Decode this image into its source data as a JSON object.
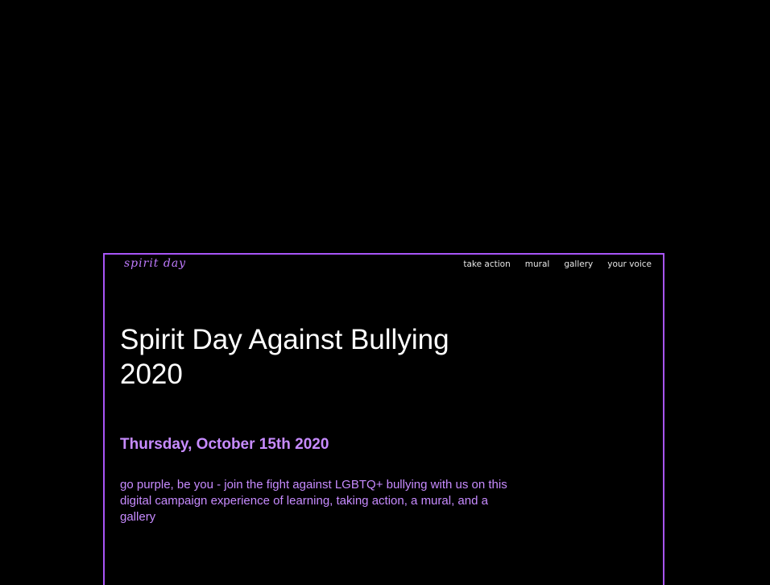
{
  "header": {
    "logo_text": "spirit day",
    "nav": [
      {
        "label": "take action"
      },
      {
        "label": "mural"
      },
      {
        "label": "gallery"
      },
      {
        "label": "your voice"
      }
    ]
  },
  "hero": {
    "title": "Spirit Day Against Bullying 2020",
    "date": "Thursday, October 15th 2020",
    "description": "go purple, be you - join the fight against LGBTQ+ bullying with us on this digital campaign experience of learning, taking action, a mural, and a gallery"
  },
  "colors": {
    "background": "#000000",
    "accent": "#a855f7",
    "text_purple": "#c78bff",
    "text_white": "#ffffff"
  }
}
